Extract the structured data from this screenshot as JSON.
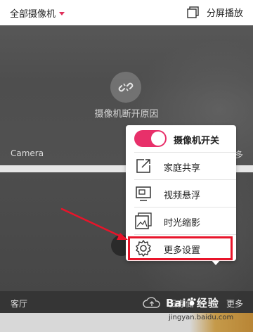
{
  "header": {
    "filter_label": "全部摄像机",
    "split_label": "分屏播放"
  },
  "camera1": {
    "name": "Camera",
    "status_text": "摄像机断开原因",
    "more_fragment": "多"
  },
  "camera2": {
    "name": "客厅",
    "cloud_label": "云存储",
    "more_label": "更多"
  },
  "menu": {
    "items": [
      {
        "label": "摄像机开关",
        "icon": "toggle-switch",
        "state": "on"
      },
      {
        "label": "家庭共享",
        "icon": "share-icon"
      },
      {
        "label": "视频悬浮",
        "icon": "float-video-icon"
      },
      {
        "label": "时光缩影",
        "icon": "timelapse-icon"
      },
      {
        "label": "更多设置",
        "icon": "gear-icon",
        "highlighted": true
      }
    ]
  },
  "watermark": {
    "brand": "Bai",
    "brand_suffix": "经验",
    "url": "jingyan.baidu.com"
  },
  "colors": {
    "accent": "#e8306a",
    "highlight_box": "#e8142a",
    "arrow": "#e8142a"
  }
}
